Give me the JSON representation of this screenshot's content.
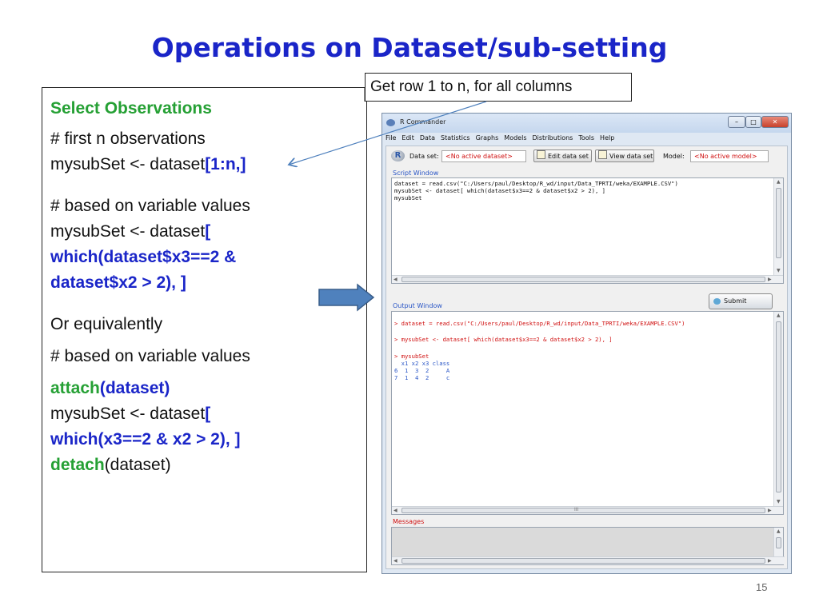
{
  "slide": {
    "title": "Operations on Dataset/sub-setting",
    "page_number": "15",
    "callout": "Get row 1 to n, for all columns"
  },
  "left_panel": {
    "heading": "Select Observations",
    "comment1": "# first n observations",
    "l1_prefix": "mysubSet <- dataset",
    "l1_bold": "[1:n,]",
    "comment2": "# based on variable values",
    "l2_prefix": "mysubSet <- dataset",
    "l2_bold": "[",
    "l3": "which(dataset$x3==2 &",
    "l4": "dataset$x2 > 2), ]",
    "or_text": "Or equivalently",
    "comment3": "# based on variable values",
    "attach_kw": "attach",
    "attach_arg": "(dataset)",
    "l5_prefix": "mysubSet <- dataset",
    "l5_bold": "[",
    "l6": "which(x3==2 & x2 > 2), ]",
    "detach_kw": "detach",
    "detach_arg": "(dataset)"
  },
  "rcmdr": {
    "window_title": "R Commander",
    "menu": [
      "File",
      "Edit",
      "Data",
      "Statistics",
      "Graphs",
      "Models",
      "Distributions",
      "Tools",
      "Help"
    ],
    "dataset_label": "Data set:",
    "dataset_value": "<No active dataset>",
    "edit_btn": "Edit data set",
    "view_btn": "View data set",
    "model_label": "Model:",
    "model_value": "<No active model>",
    "script_title": "Script Window",
    "script_lines": [
      "dataset = read.csv(\"C:/Users/paul/Desktop/R_wd/input/Data_TPRTI/weka/EXAMPLE.CSV\")",
      "mysubSet <- dataset[ which(dataset$x3==2 & dataset$x2 > 2), ]",
      "mysubSet"
    ],
    "submit_label": "Submit",
    "output_title": "Output Window",
    "output_lines": [
      "> dataset = read.csv(\"C:/Users/paul/Desktop/R_wd/input/Data_TPRTI/weka/EXAMPLE.CSV\")",
      "> mysubSet <- dataset[ which(dataset$x3==2 & dataset$x2 > 2), ]",
      "> mysubSet"
    ],
    "table_header": "  x1 x2 x3 class",
    "table_rows": [
      "6  1  3  2     A",
      "7  1  4  2     c"
    ],
    "hscroll_mark": "III",
    "messages_title": "Messages"
  },
  "colors": {
    "title_blue": "#1a25c8",
    "keyword_green": "#25a034",
    "rcmdr_red": "#d01010",
    "rcmdr_blue": "#2a56c6",
    "arrow_blue": "#4f81bd"
  }
}
